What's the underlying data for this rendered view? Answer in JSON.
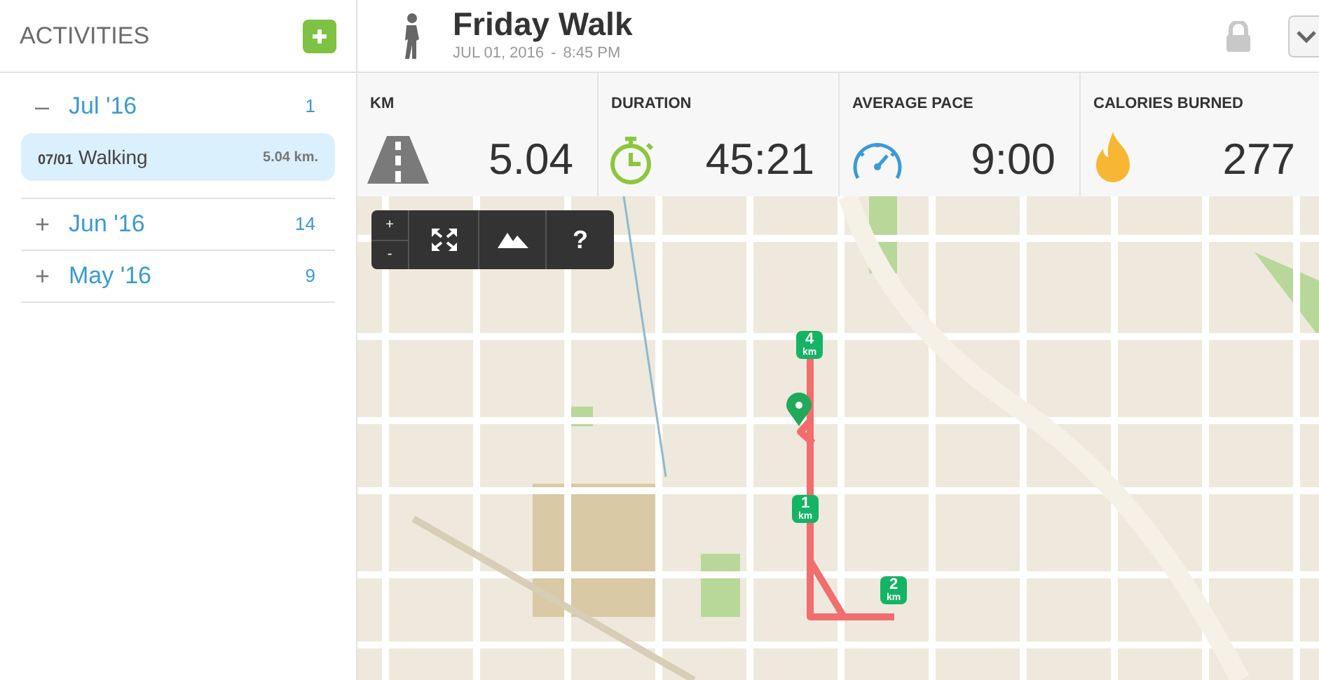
{
  "sidebar": {
    "title": "ACTIVITIES",
    "groups": [
      {
        "label": "Jul '16",
        "count": "1",
        "toggle": "–",
        "items": [
          {
            "date": "07/01",
            "name": "Walking",
            "distance": "5.04 km.",
            "selected": true
          }
        ]
      },
      {
        "label": "Jun '16",
        "count": "14",
        "toggle": "+"
      },
      {
        "label": "May '16",
        "count": "9",
        "toggle": "+"
      }
    ]
  },
  "activity": {
    "title": "Friday Walk",
    "date": "JUL 01, 2016",
    "separator": "-",
    "time": "8:45 PM",
    "locked": true
  },
  "stats": [
    {
      "kind": "road",
      "label": "KM",
      "value": "5.04"
    },
    {
      "kind": "timer",
      "label": "DURATION",
      "value": "45:21"
    },
    {
      "kind": "gauge",
      "label": "AVERAGE PACE",
      "value": "9:00"
    },
    {
      "kind": "flame",
      "label": "CALORIES BURNED",
      "value": "277"
    }
  ],
  "map": {
    "zoom_in": "+",
    "zoom_out": "-",
    "help": "?",
    "markers": [
      {
        "number": "4",
        "unit": "km"
      },
      {
        "number": "1",
        "unit": "km"
      },
      {
        "number": "2",
        "unit": "km"
      }
    ]
  }
}
